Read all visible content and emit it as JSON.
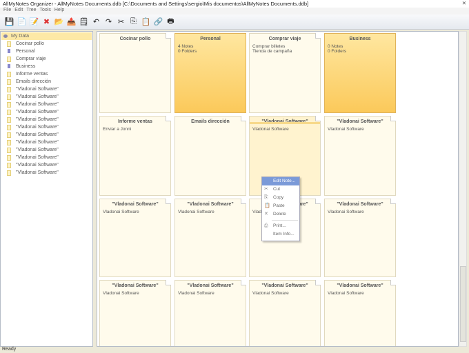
{
  "title": "AllMyNotes Organizer - AllMyNotes Documents.ddb [C:\\Documents and Settings\\sergio\\Mis documentos\\AllMyNotes Documents.ddb]",
  "menu": [
    "File",
    "Edit",
    "Tree",
    "Tools",
    "Help"
  ],
  "toolbar": [
    "save-icon",
    "new-note-icon",
    "new-child-note-icon",
    "delete-icon",
    "import-icon",
    "export-icon",
    "note-icon",
    "undo-icon",
    "redo-icon",
    "cut-icon",
    "copy-icon",
    "paste-icon",
    "link-icon",
    "print-icon"
  ],
  "tree": {
    "root": "My Data",
    "items": [
      {
        "label": "Cocinar pollo",
        "type": "note"
      },
      {
        "label": "Personal",
        "type": "folder"
      },
      {
        "label": "Comprar viaje",
        "type": "note"
      },
      {
        "label": "Business",
        "type": "folder"
      },
      {
        "label": "Informe ventas",
        "type": "note"
      },
      {
        "label": "Emails dirección",
        "type": "note"
      },
      {
        "label": "\"Vladonai Software\"",
        "type": "note"
      },
      {
        "label": "\"Vladonai Software\"",
        "type": "note"
      },
      {
        "label": "\"Vladonai Software\"",
        "type": "note"
      },
      {
        "label": "\"Vladonai Software\"",
        "type": "note"
      },
      {
        "label": "\"Vladonai Software\"",
        "type": "note"
      },
      {
        "label": "\"Vladonai Software\"",
        "type": "note"
      },
      {
        "label": "\"Vladonai Software\"",
        "type": "note"
      },
      {
        "label": "\"Vladonai Software\"",
        "type": "note"
      },
      {
        "label": "\"Vladonai Software\"",
        "type": "note"
      },
      {
        "label": "\"Vladonai Software\"",
        "type": "note"
      },
      {
        "label": "\"Vladonai Software\"",
        "type": "note"
      },
      {
        "label": "\"Vladonai Software\"",
        "type": "note"
      }
    ]
  },
  "cards": [
    {
      "title": "Cocinar pollo",
      "lines": [],
      "type": "note"
    },
    {
      "title": "Personal",
      "lines": [
        "4 Notes",
        "0 Folders"
      ],
      "type": "folder"
    },
    {
      "title": "Comprar viaje",
      "lines": [
        "Comprar billetes",
        "Tienda de campaña"
      ],
      "type": "note"
    },
    {
      "title": "Business",
      "lines": [
        "0 Notes",
        "0 Folders"
      ],
      "type": "folder"
    },
    {
      "title": "Informe ventas",
      "lines": [
        "Enviar a Jonni"
      ],
      "type": "note"
    },
    {
      "title": "Emails dirección",
      "lines": [],
      "type": "note"
    },
    {
      "title": "\"Vladonai Software\"",
      "lines": [
        "Vladonai Software"
      ],
      "type": "sel"
    },
    {
      "title": "\"Vladonai Software\"",
      "lines": [
        "Vladonai Software"
      ],
      "type": "note"
    },
    {
      "title": "\"Vladonai Software\"",
      "lines": [
        "Vladonai Software"
      ],
      "type": "note"
    },
    {
      "title": "\"Vladonai Software\"",
      "lines": [
        "Vladonai Software"
      ],
      "type": "note"
    },
    {
      "title": "\"Vladonai Software\"",
      "lines": [
        "Vladonai Software"
      ],
      "type": "note"
    },
    {
      "title": "\"Vladonai Software\"",
      "lines": [
        "Vladonai Software"
      ],
      "type": "note"
    },
    {
      "title": "\"Vladonai Software\"",
      "lines": [
        "Vladonai Software"
      ],
      "type": "note"
    },
    {
      "title": "\"Vladonai Software\"",
      "lines": [
        "Vladonai Software"
      ],
      "type": "note"
    },
    {
      "title": "\"Vladonai Software\"",
      "lines": [
        "Vladonai Software"
      ],
      "type": "note"
    },
    {
      "title": "\"Vladonai Software\"",
      "lines": [
        "Vladonai Software"
      ],
      "type": "note"
    }
  ],
  "context_menu": [
    {
      "label": "Edit Note...",
      "icon": "",
      "hi": true
    },
    {
      "label": "Cut",
      "icon": "✂"
    },
    {
      "label": "Copy",
      "icon": "⎘"
    },
    {
      "label": "Paste",
      "icon": "📋"
    },
    {
      "label": "Delete",
      "icon": "✕"
    },
    {
      "sep": true
    },
    {
      "label": "Print...",
      "icon": "⎙"
    },
    {
      "label": "Item Info...",
      "icon": ""
    }
  ],
  "status": "Ready"
}
